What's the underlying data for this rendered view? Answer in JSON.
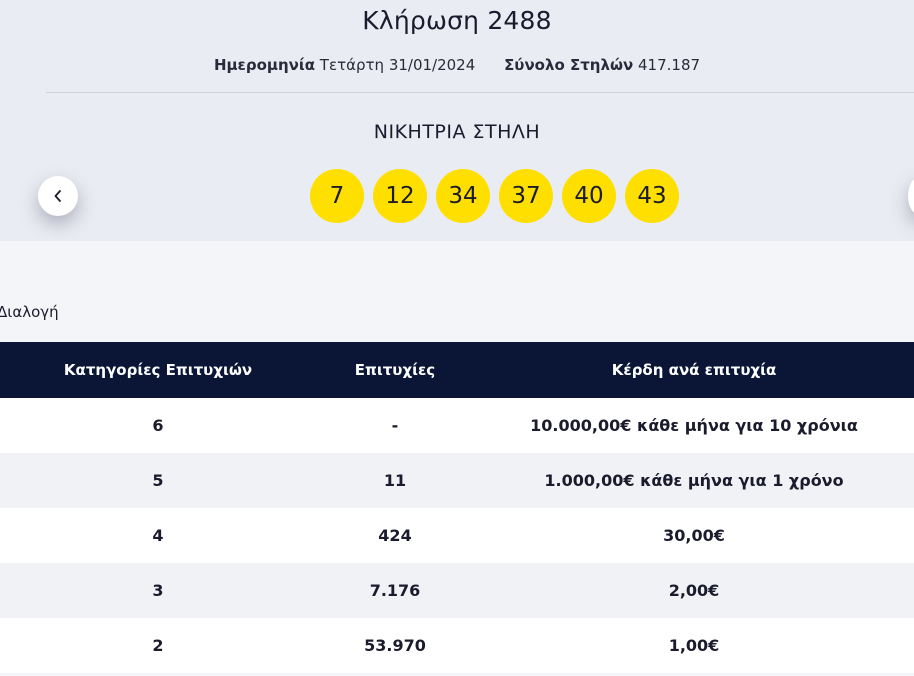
{
  "draw": {
    "title": "Κλήρωση 2488",
    "date_label": "Ημερομηνία",
    "date_value": "Τετάρτη 31/01/2024",
    "columns_label": "Σύνολο Στηλών",
    "columns_value": "417.187"
  },
  "winning": {
    "label": "ΝΙΚΗΤΡΙΑ ΣΤΗΛΗ",
    "numbers": [
      "7",
      "12",
      "34",
      "37",
      "40",
      "43"
    ],
    "ball_color": "#ffdf00"
  },
  "navigation": {
    "prev_icon": "chevron-left-icon"
  },
  "section": {
    "label": "Διαλογή"
  },
  "table": {
    "headers": [
      "Κατηγορίες Επιτυχιών",
      "Επιτυχίες",
      "Κέρδη ανά επιτυχία"
    ],
    "header_bg": "#0b1636",
    "rows": [
      [
        "6",
        "-",
        "10.000,00€ κάθε μήνα για 10 χρόνια"
      ],
      [
        "5",
        "11",
        "1.000,00€ κάθε μήνα για 1 χρόνο"
      ],
      [
        "4",
        "424",
        "30,00€"
      ],
      [
        "3",
        "7.176",
        "2,00€"
      ],
      [
        "2",
        "53.970",
        "1,00€"
      ]
    ]
  }
}
